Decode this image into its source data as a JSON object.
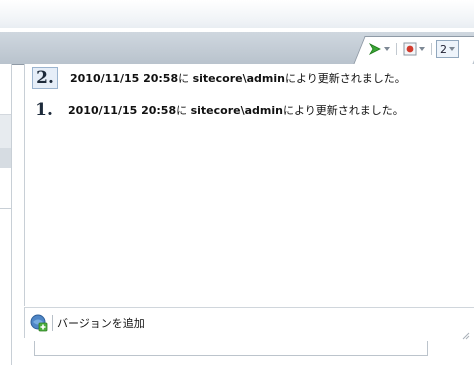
{
  "toolbar": {
    "count_label": "2"
  },
  "versions": [
    {
      "number": "2.",
      "date": "2010/11/15 20:58",
      "particle": "に",
      "user": "sitecore\\admin",
      "suffix": "により更新されました。",
      "selected": true
    },
    {
      "number": "1.",
      "date": "2010/11/15 20:58",
      "particle": "に",
      "user": "sitecore\\admin",
      "suffix": "により更新されました。",
      "selected": false
    }
  ],
  "footer": {
    "add_version_label": "バージョンを追加"
  },
  "icons": {
    "tab_tools": [
      "green-arrow-icon",
      "red-record-icon"
    ],
    "footer": "add-version-icon"
  },
  "colors": {
    "selected_badge_bg": "#e6eef8",
    "selected_badge_border": "#9bb4cf",
    "record_red": "#d23a2c",
    "arrow_green": "#3aa635"
  }
}
